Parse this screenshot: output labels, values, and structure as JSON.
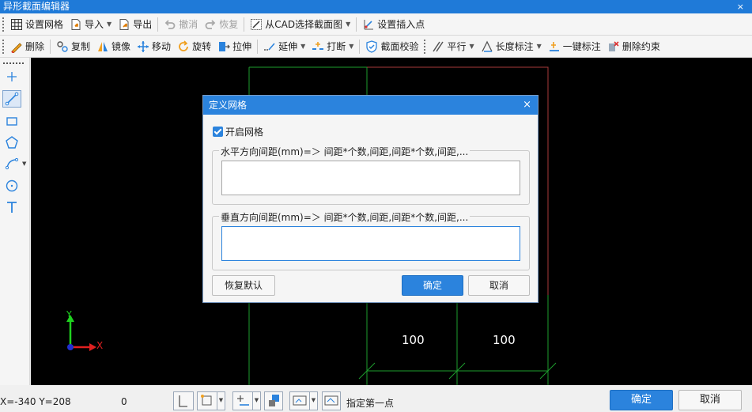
{
  "app": {
    "title": "异形截面编辑器",
    "close_glyph": "×"
  },
  "toolbar1": {
    "items": [
      {
        "label": "设置网格",
        "icon": "grid-icon"
      },
      {
        "label": "导入",
        "icon": "import-icon",
        "dropdown": true
      },
      {
        "label": "导出",
        "icon": "export-icon"
      },
      {
        "label": "撤消",
        "icon": "undo-icon",
        "disabled": true
      },
      {
        "label": "恢复",
        "icon": "redo-icon",
        "disabled": true
      },
      {
        "label": "从CAD选择截面图",
        "icon": "cad-select-icon",
        "dropdown": true
      },
      {
        "label": "设置插入点",
        "icon": "insert-point-icon"
      }
    ]
  },
  "toolbar2": {
    "items": [
      {
        "label": "删除",
        "icon": "eraser-icon"
      },
      {
        "label": "复制",
        "icon": "copy-icon"
      },
      {
        "label": "镜像",
        "icon": "mirror-icon"
      },
      {
        "label": "移动",
        "icon": "move-icon"
      },
      {
        "label": "旋转",
        "icon": "rotate-icon"
      },
      {
        "label": "拉伸",
        "icon": "stretch-icon"
      },
      {
        "label": "延伸",
        "icon": "extend-icon",
        "dropdown": true
      },
      {
        "label": "打断",
        "icon": "break-icon",
        "dropdown": true
      },
      {
        "label": "截面校验",
        "icon": "shield-check-icon"
      },
      {
        "label": "平行",
        "icon": "parallel-icon",
        "dropdown": true
      },
      {
        "label": "长度标注",
        "icon": "length-dimension-icon",
        "dropdown": true
      },
      {
        "label": "一键标注",
        "icon": "one-click-dimension-icon"
      },
      {
        "label": "删除约束",
        "icon": "delete-constraint-icon"
      }
    ]
  },
  "canvas": {
    "dim_left": "100",
    "dim_right": "100",
    "axis_y": "Y",
    "axis_x": "X"
  },
  "status": {
    "coords": "X=-340 Y=208",
    "value": "0",
    "hint": "指定第一点",
    "ok": "确定",
    "cancel": "取消"
  },
  "dialog": {
    "title": "定义网格",
    "close_glyph": "×",
    "enable_grid_label": "开启网格",
    "enable_grid_checked": true,
    "horizontal_legend": "水平方向间距(mm)=＞ 间距*个数,间距,间距*个数,间距,...",
    "horizontal_value": "",
    "vertical_legend": "垂直方向间距(mm)=＞ 间距*个数,间距,间距*个数,间距,...",
    "vertical_value": "",
    "restore_default": "恢复默认",
    "ok": "确定",
    "cancel": "取消"
  },
  "colors": {
    "accent": "#2b83dd",
    "canvas_bg": "#000000",
    "grid_line": "#1e9e2e",
    "boundary_line": "#a83a3a"
  }
}
